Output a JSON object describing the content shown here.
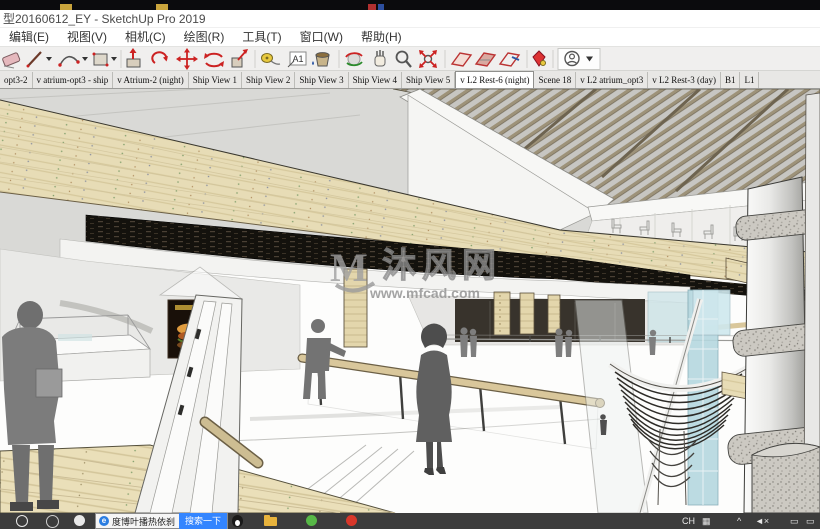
{
  "window": {
    "title": "型20160612_EY - SketchUp Pro 2019"
  },
  "menu_bar": {
    "items": [
      {
        "label": "编辑(E)"
      },
      {
        "label": "视图(V)"
      },
      {
        "label": "相机(C)"
      },
      {
        "label": "绘图(R)"
      },
      {
        "label": "工具(T)"
      },
      {
        "label": "窗口(W)"
      },
      {
        "label": "帮助(H)"
      }
    ]
  },
  "toolbar": {
    "icons": [
      "eraser",
      "line",
      "arc",
      "rectangle",
      "push-pull",
      "follow-me",
      "move",
      "rotate",
      "scale",
      "tape-measure",
      "text",
      "paint-bucket",
      "orbit",
      "pan",
      "zoom",
      "zoom-extents",
      "section-plane",
      "section-fill",
      "section-display",
      "component",
      "sign-in"
    ]
  },
  "scene_tabs": {
    "items": [
      {
        "label": "opt3-2",
        "active": false
      },
      {
        "label": "v atrium-opt3 - ship",
        "active": false
      },
      {
        "label": "v Atrium-2 (night)",
        "active": false
      },
      {
        "label": "Ship View 1",
        "active": false
      },
      {
        "label": "Ship View 2",
        "active": false
      },
      {
        "label": "Ship View 3",
        "active": false
      },
      {
        "label": "Ship View 4",
        "active": false
      },
      {
        "label": "Ship View 5",
        "active": false
      },
      {
        "label": "v L2 Rest-6 (night)",
        "active": true
      },
      {
        "label": "Scene 18",
        "active": false
      },
      {
        "label": "v L2 atrium_opt3",
        "active": false
      },
      {
        "label": "v L2 Rest-3 (day)",
        "active": false
      },
      {
        "label": "B1",
        "active": false
      },
      {
        "label": "L1",
        "active": false
      }
    ]
  },
  "viewport": {
    "watermark": {
      "logo_letter": "M",
      "site_name": "沐风网",
      "site_url": "www.mfcad.com"
    }
  },
  "taskbar": {
    "app_button": {
      "label": "度博叶播热依刹",
      "search_label": "搜索一下"
    },
    "tray": {
      "language_indicator": "CH"
    }
  },
  "colors": {
    "wood": "#e7dcb6",
    "dark_soffit": "#14120d",
    "glass_cyan": "#b5d8e0",
    "taskbar_bg": "#3c3c3c",
    "baidu_blue": "#3385ff",
    "title_text": "#4a4a4a"
  }
}
